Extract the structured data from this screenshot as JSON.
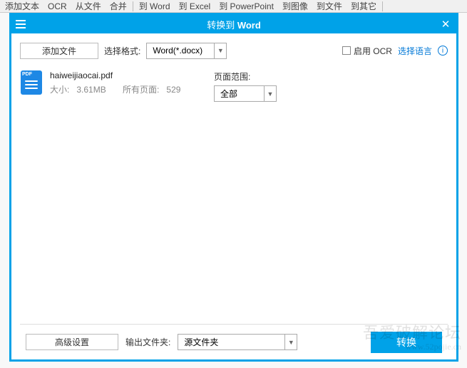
{
  "bg_toolbar": {
    "items": [
      "添加文本",
      "OCR",
      "从文件",
      "合并",
      "到 Word",
      "到 Excel",
      "到 PowerPoint",
      "到图像",
      "到文件",
      "到其它"
    ],
    "seps_after": [
      3,
      9
    ]
  },
  "titlebar": {
    "prefix": "转换到 ",
    "bold": "Word"
  },
  "top": {
    "add_file": "添加文件",
    "format_label": "选择格式:",
    "format_value": "Word(*.docx)",
    "enable_ocr": "启用 OCR",
    "select_lang": "选择语言",
    "info": "i"
  },
  "file": {
    "name": "haiweijiaocai.pdf",
    "size_label": "大小:",
    "size_value": "3.61MB",
    "pages_label": "所有页面:",
    "pages_value": "529",
    "icon_tag": "PDF"
  },
  "range": {
    "label": "页面范围:",
    "value": "全部"
  },
  "bottom": {
    "advanced": "高级设置",
    "output_label": "输出文件夹:",
    "output_value": "源文件夹",
    "convert": "转换"
  },
  "watermark": {
    "main": "吾爱破解论坛",
    "sub": "www.52pojie.cn"
  }
}
